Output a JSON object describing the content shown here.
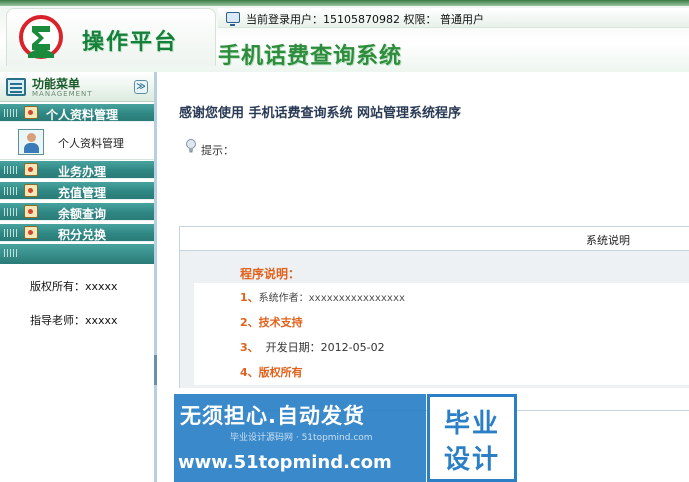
{
  "header": {
    "brand": "操作平台",
    "system_title": "手机话费查询系统",
    "user_info": "当前登录用户：15105870982  权限：  普通用户"
  },
  "sidebar": {
    "menu_title": "功能菜单",
    "menu_subtitle": "MANAGEMENT",
    "collapse_symbol": "≫",
    "sections": [
      {
        "label": "个人资料管理",
        "icon": "profile-folder-icon"
      },
      {
        "label": "业务办理",
        "icon": "business-icon"
      },
      {
        "label": "充值管理",
        "icon": "recharge-icon"
      },
      {
        "label": "余额查询",
        "icon": "balance-icon"
      },
      {
        "label": "积分兑换",
        "icon": "points-icon"
      }
    ],
    "sub_item": {
      "label": "个人资料管理",
      "icon": "user-profile-icon"
    },
    "copyright": "版权所有：xxxxx",
    "teacher": "指导老师：xxxxx"
  },
  "main": {
    "welcome": "感谢您使用 手机话费查询系统 网站管理系统程序",
    "hint_label": "提示：",
    "panel_title": "系统说明",
    "program_desc_title": "程序说明：",
    "items": [
      {
        "num": "1、",
        "text": "系统作者：xxxxxxxxxxxxxxxx"
      },
      {
        "num": "2、",
        "text": "技术支持"
      },
      {
        "num": "3、",
        "text": "  开发日期：2012-05-02"
      },
      {
        "num": "4、",
        "text": "版权所有"
      }
    ]
  },
  "ad": {
    "slogan": "无须担心.自动发货",
    "small_text": "毕业设计源码网 · 51topmind.com",
    "url": "www.51topmind.com",
    "badge_line1": "毕业",
    "badge_line2": "设计"
  },
  "colors": {
    "brand_green": "#14803a",
    "nav_teal": "#2f8783",
    "accent_orange": "#e0621c",
    "ad_blue": "#2a7fc6"
  }
}
